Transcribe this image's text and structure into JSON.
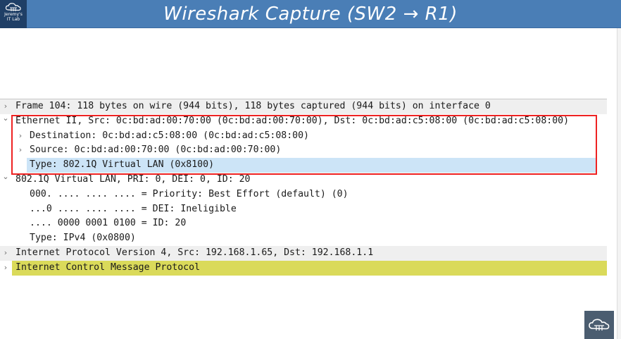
{
  "header": {
    "title": "Wireshark Capture (SW2 → R1)",
    "logo_text_line1": "Jeremy's",
    "logo_text_line2": "IT Lab",
    "background_color": "#4a7eb6"
  },
  "packet_details": [
    {
      "arrow": "›",
      "expanded": false,
      "indent": 0,
      "text": "Frame 104: 118 bytes on wire (944 bits), 118 bytes captured (944 bits) on interface 0"
    },
    {
      "arrow": "⌄",
      "expanded": true,
      "indent": 0,
      "text": "Ethernet II, Src: 0c:bd:ad:00:70:00 (0c:bd:ad:00:70:00), Dst: 0c:bd:ad:c5:08:00 (0c:bd:ad:c5:08:00)"
    },
    {
      "arrow": "›",
      "expanded": false,
      "indent": 1,
      "text": "Destination: 0c:bd:ad:c5:08:00 (0c:bd:ad:c5:08:00)"
    },
    {
      "arrow": "›",
      "expanded": false,
      "indent": 1,
      "text": "Source: 0c:bd:ad:00:70:00 (0c:bd:ad:00:70:00)"
    },
    {
      "arrow": "",
      "expanded": false,
      "indent": 1,
      "text": "Type: 802.1Q Virtual LAN (0x8100)",
      "selected": true
    },
    {
      "arrow": "⌄",
      "expanded": true,
      "indent": 0,
      "text": "802.1Q Virtual LAN, PRI: 0, DEI: 0, ID: 20"
    },
    {
      "arrow": "",
      "expanded": false,
      "indent": 1,
      "text": "000. .... .... .... = Priority: Best Effort (default) (0)"
    },
    {
      "arrow": "",
      "expanded": false,
      "indent": 1,
      "text": "...0 .... .... .... = DEI: Ineligible"
    },
    {
      "arrow": "",
      "expanded": false,
      "indent": 1,
      "text": ".... 0000 0001 0100 = ID: 20"
    },
    {
      "arrow": "",
      "expanded": false,
      "indent": 1,
      "text": "Type: IPv4 (0x0800)"
    },
    {
      "arrow": "›",
      "expanded": false,
      "indent": 0,
      "text": "Internet Protocol Version 4, Src: 192.168.1.65, Dst: 192.168.1.1"
    },
    {
      "arrow": "›",
      "expanded": false,
      "indent": 0,
      "text": "Internet Control Message Protocol",
      "highlight_color": "#dada5a"
    }
  ],
  "annotation": {
    "box_color": "#ee2222"
  }
}
